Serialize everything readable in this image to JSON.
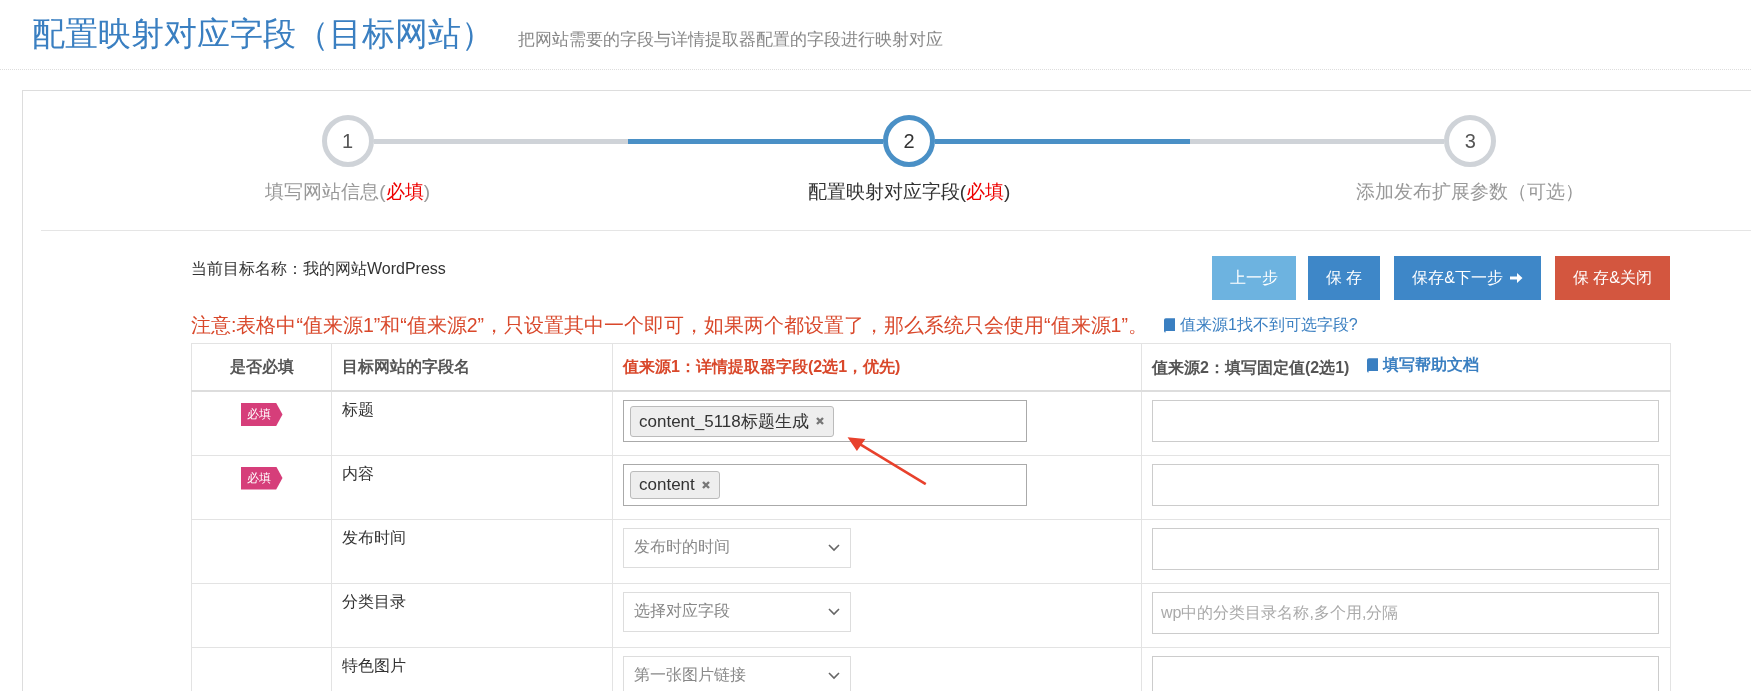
{
  "header": {
    "title": "配置映射对应字段（目标网站）",
    "subtitle": "把网站需要的字段与详情提取器配置的字段进行映射对应"
  },
  "steps": [
    {
      "number": "1",
      "label": "填写网站信息(",
      "mark": "必填",
      "tail": ")",
      "selected": false
    },
    {
      "number": "2",
      "label": "配置映射对应字段(",
      "mark": "必填",
      "tail": ")",
      "selected": true
    },
    {
      "number": "3",
      "label": "添加发布扩展参数（可选）",
      "selected": false
    }
  ],
  "target": {
    "label": "当前目标名称：",
    "name": "我的网站WordPress"
  },
  "buttons": [
    {
      "label": "上一步",
      "kind": "light"
    },
    {
      "label": "保 存",
      "kind": "primary"
    },
    {
      "label": "保存&下一步",
      "kind": "primary",
      "arrow": true
    },
    {
      "label": "保 存&关闭",
      "kind": "danger"
    }
  ],
  "notice": {
    "text": "注意:表格中“值来源1”和“值来源2”，只设置其中一个即可，如果两个都设置了，那么系统只会使用“值来源1”。",
    "link": "值来源1找不到可选字段?"
  },
  "table": {
    "columns": [
      {
        "label": "是否必填",
        "kind": "center"
      },
      {
        "label": "目标网站的字段名",
        "kind": "plain"
      },
      {
        "label": "值来源1：详情提取器字段(2选1，优先)",
        "kind": "highlight"
      },
      {
        "label": "值来源2：填写固定值(2选1)",
        "kind": "plain",
        "link": "填写帮助文档"
      }
    ],
    "rows": [
      {
        "required": true,
        "badge": "必填",
        "field": "标题",
        "source1": {
          "kind": "tags",
          "tags": [
            "content_5118标题生成"
          ]
        },
        "source2": {}
      },
      {
        "required": true,
        "badge": "必填",
        "field": "内容",
        "source1": {
          "kind": "tags",
          "tags": [
            "content"
          ]
        },
        "source2": {}
      },
      {
        "required": false,
        "field": "发布时间",
        "source1": {
          "kind": "select",
          "value": "发布时的时间"
        },
        "source2": {}
      },
      {
        "required": false,
        "field": "分类目录",
        "source1": {
          "kind": "select",
          "value": "选择对应字段"
        },
        "source2": {
          "placeholder": "wp中的分类目录名称,多个用,分隔"
        }
      },
      {
        "required": false,
        "field": "特色图片",
        "source1": {
          "kind": "select",
          "value": "第一张图片链接"
        },
        "source2": {}
      }
    ]
  }
}
